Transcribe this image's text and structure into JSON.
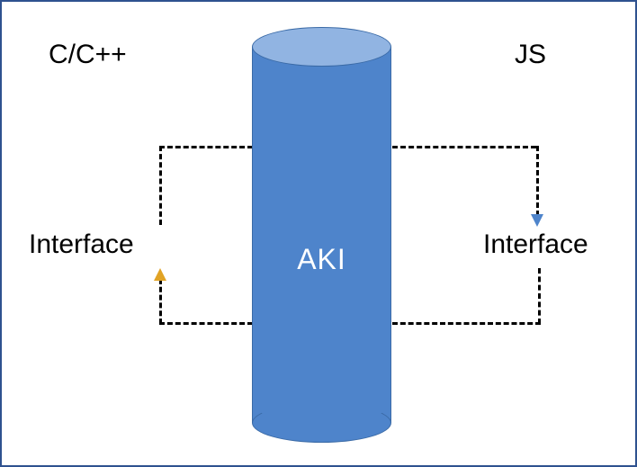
{
  "labels": {
    "top_left": "C/C++",
    "top_right": "JS",
    "left_interface": "Interface",
    "right_interface": "Interface",
    "cylinder": "AKI"
  },
  "arrows": {
    "blue": {
      "color": "#4e84cb",
      "from": "left_interface",
      "to": "right_interface",
      "via": "top"
    },
    "gold": {
      "color": "#e1a325",
      "from": "right_interface",
      "to": "left_interface",
      "via": "bottom"
    }
  }
}
